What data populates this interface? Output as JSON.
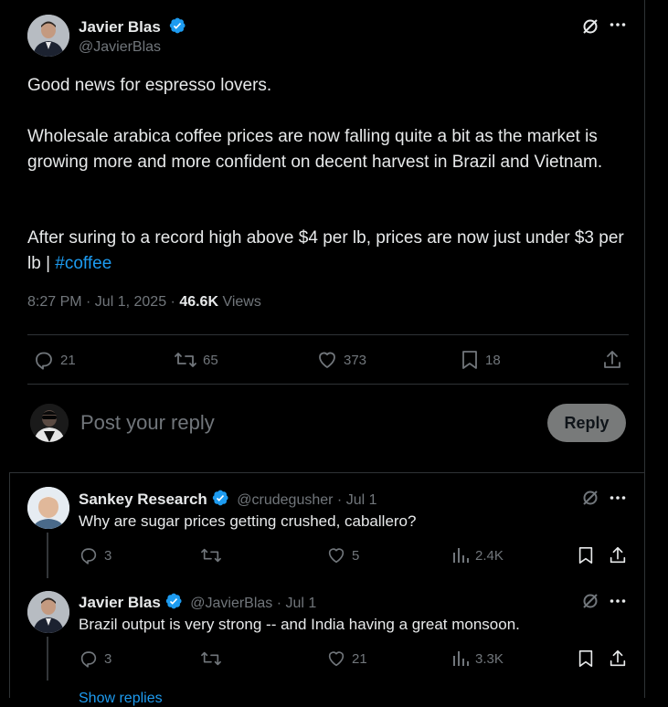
{
  "main_tweet": {
    "author_name": "Javier Blas",
    "author_handle": "@JavierBlas",
    "para1": "Good news for espresso lovers.",
    "para2": "Wholesale arabica coffee prices are now falling quite a bit as the market is growing more and more confident on decent harvest in Brazil and Vietnam.",
    "para3_text": "After suring to a record high above $4 per lb, prices are now just under $3 per lb | ",
    "hashtag": "#coffee",
    "time": "8:27 PM · Jul 1, 2025 · ",
    "views_count": "46.6K",
    "views_label": " Views",
    "replies": "21",
    "reposts": "65",
    "likes": "373",
    "bookmarks": "18"
  },
  "composer": {
    "placeholder": "Post your reply",
    "reply_button": "Reply"
  },
  "replies": [
    {
      "name": "Sankey Research",
      "handle": "@crudegusher",
      "date": "· Jul 1",
      "text": "Why are sugar prices getting crushed, caballero?",
      "replies": "3",
      "likes": "5",
      "views": "2.4K"
    },
    {
      "name": "Javier Blas",
      "handle": "@JavierBlas",
      "date": "· Jul 1",
      "text": "Brazil output is very strong -- and India having a great monsoon.",
      "replies": "3",
      "likes": "21",
      "views": "3.3K"
    }
  ],
  "show_replies": "Show replies",
  "colors": {
    "accent": "#1d9bf0",
    "muted": "#71767b",
    "text": "#e7e9ea",
    "verified": "#1d9bf0"
  }
}
